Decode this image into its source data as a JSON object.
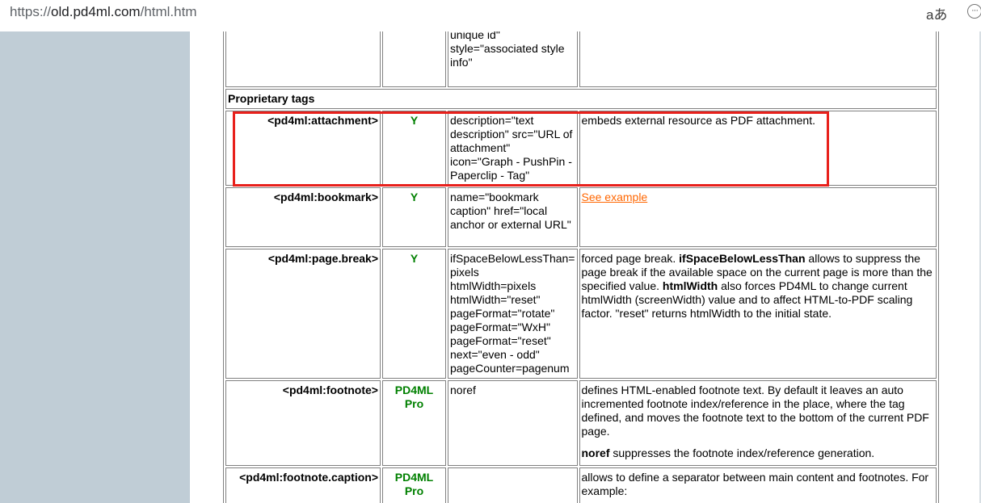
{
  "browser": {
    "url_scheme": "https://",
    "url_host": "old.pd4ml.com",
    "url_path": "/html.htm",
    "read_aloud_label": "aあ",
    "more_label": "···"
  },
  "top_partial_row": {
    "attrs": [
      "id=\"document-wide unique id\"",
      "style=\"associated style info\""
    ]
  },
  "section_title": "Proprietary tags",
  "rows": [
    {
      "tag": "<pd4ml:attachment>",
      "support": "Y",
      "attrs": "description=\"text description\" src=\"URL of attachment\" icon=\"Graph - PushPin - Paperclip - Tag\"",
      "desc": "embeds external resource as PDF attachment."
    },
    {
      "tag": "<pd4ml:bookmark>",
      "support": "Y",
      "attrs": "name=\"bookmark caption\" href=\"local anchor or external URL\"",
      "link": "See example"
    },
    {
      "tag": "<pd4ml:page.break>",
      "support": "Y",
      "attrs": [
        "ifSpaceBelowLessThan= pixels",
        "htmlWidth=pixels",
        "htmlWidth=\"reset\"",
        "pageFormat=\"rotate\"",
        "pageFormat=\"WxH\"",
        "pageFormat=\"reset\"",
        "next=\"even - odd\"",
        "pageCounter=pagenum"
      ],
      "desc_pre": "forced page break. ",
      "desc_b1": "ifSpaceBelowLessThan",
      "desc_mid": " allows to suppress the page break if the available space on the current page is more than the specified value. ",
      "desc_b2": "htmlWidth",
      "desc_post": " also forces PD4ML to change current htmlWidth (screenWidth) value and to affect HTML-to-PDF scaling factor. \"reset\" returns htmlWidth to the initial state."
    },
    {
      "tag": "<pd4ml:footnote>",
      "support_line1": "PD4ML",
      "support_line2": "Pro",
      "attrs": "noref",
      "desc_p1": "defines HTML-enabled footnote text. By default it leaves an auto incremented footnote index/reference in the place, where the tag defined, and moves the footnote text to the bottom of the current PDF page.",
      "desc_b": "noref",
      "desc_p2": " suppresses the footnote index/reference generation."
    },
    {
      "tag": "<pd4ml:footnote.caption>",
      "support_line1": "PD4ML",
      "support_line2": "Pro",
      "attrs": "",
      "desc": "allows to define a separator between main content and footnotes. For example:"
    }
  ],
  "colors": {
    "green": "#008000",
    "link": "#ff6600",
    "highlight": "#e8201b",
    "gutter": "#c0cdd6"
  }
}
